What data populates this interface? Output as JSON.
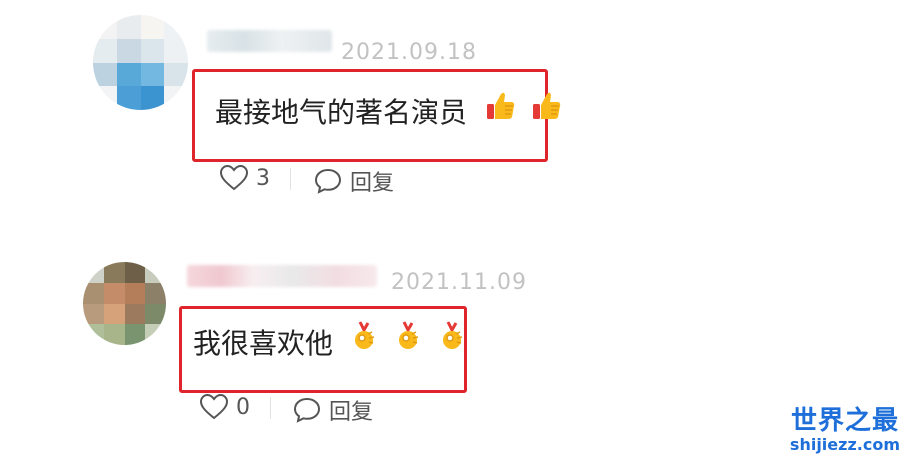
{
  "comments": [
    {
      "date": "2021.09.18",
      "text": "最接地气的著名演员",
      "emojis": [
        "thumbs-up",
        "thumbs-up"
      ],
      "likes": "3",
      "reply_label": "回复",
      "avatar_colors": [
        "#f3f3f3",
        "#e9ecee",
        "#f7f5f1",
        "#eef2f4",
        "#e4ecf0",
        "#c9d8e2",
        "#dbe6ec",
        "#eef1f3",
        "#bcd2e0",
        "#58a9d8",
        "#73b8e0",
        "#d9e4ea",
        "#f2f4f6",
        "#4b9fd6",
        "#3b93d0",
        "#f1f3f5"
      ]
    },
    {
      "date": "2021.11.09",
      "text": "我很喜欢他",
      "emojis": [
        "ok-hand",
        "ok-hand",
        "ok-hand"
      ],
      "likes": "0",
      "reply_label": "回复",
      "avatar_colors": [
        "#cfd2c8",
        "#8a7a5c",
        "#6e6048",
        "#c8ccbc",
        "#a99070",
        "#c48c68",
        "#b57e5a",
        "#8c8068",
        "#b89a7c",
        "#d6a27a",
        "#9c7a5e",
        "#7c8a6a",
        "#aebf9a",
        "#a8b48a",
        "#7a9470",
        "#c4cdb6"
      ]
    }
  ],
  "watermark": {
    "logo": "世界之最",
    "site": "shijiezz.com",
    "color": "#1e6fd9"
  },
  "colors": {
    "highlight": "#e0242b",
    "date": "#c2c2c2",
    "text": "#222222"
  }
}
